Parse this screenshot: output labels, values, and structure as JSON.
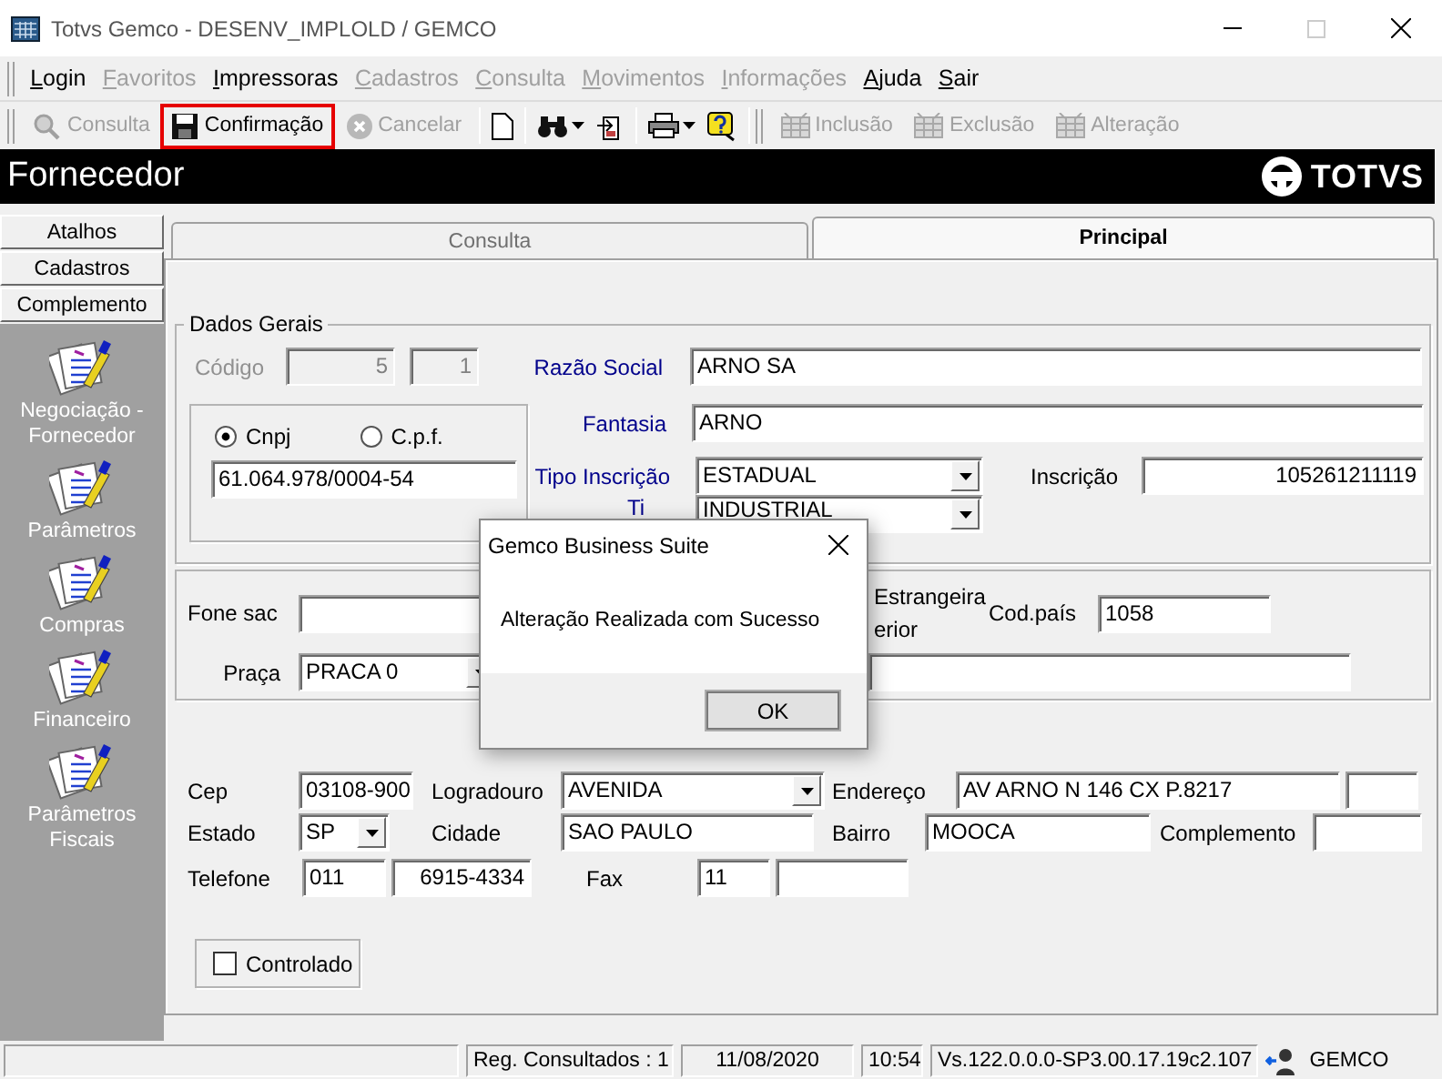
{
  "window": {
    "title": "Totvs Gemco - DESENV_IMPLOLD / GEMCO"
  },
  "menu": [
    {
      "label": "Login",
      "disabled": false
    },
    {
      "label": "Favoritos",
      "disabled": true
    },
    {
      "label": "Impressoras",
      "disabled": false
    },
    {
      "label": "Cadastros",
      "disabled": true
    },
    {
      "label": "Consulta",
      "disabled": true
    },
    {
      "label": "Movimentos",
      "disabled": true
    },
    {
      "label": "Informações",
      "disabled": true
    },
    {
      "label": "Ajuda",
      "disabled": false
    },
    {
      "label": "Sair",
      "disabled": false
    }
  ],
  "toolbar": [
    {
      "label": "Consulta",
      "disabled": true,
      "highlighted": false
    },
    {
      "label": "Confirmação",
      "disabled": false,
      "highlighted": true
    },
    {
      "label": "Cancelar",
      "disabled": true,
      "highlighted": false
    }
  ],
  "toolbar_2": [
    {
      "label": "Inclusão",
      "disabled": true
    },
    {
      "label": "Exclusão",
      "disabled": true
    },
    {
      "label": "Alteração",
      "disabled": true
    }
  ],
  "header": {
    "title": "Fornecedor",
    "logo": "TOTVS"
  },
  "sidebar": {
    "tabs": [
      {
        "label": "Atalhos"
      },
      {
        "label": "Cadastros"
      },
      {
        "label": "Complemento"
      }
    ],
    "items": [
      {
        "label": "Negociação -\nFornecedor"
      },
      {
        "label": "Parâmetros"
      },
      {
        "label": "Compras"
      },
      {
        "label": "Financeiro"
      },
      {
        "label": "Parâmetros\nFiscais"
      }
    ]
  },
  "tabs": [
    {
      "label": "Consulta",
      "selected": false
    },
    {
      "label": "Principal",
      "selected": true
    }
  ],
  "dados_gerais": {
    "title": "Dados Gerais",
    "codigo": {
      "label": "Código",
      "value": "5",
      "value_2": "1",
      "disabled": true
    },
    "razao_social": {
      "label": "Razão Social",
      "value": "ARNO SA",
      "required": true
    },
    "document_type": [
      {
        "label": "Cnpj",
        "selected": true
      },
      {
        "label": "C.p.f.",
        "selected": false
      }
    ],
    "document": "61.064.978/0004-54",
    "fantasia": {
      "label": "Fantasia",
      "value": "ARNO",
      "required": true
    },
    "tipo_inscricao": {
      "label": "Tipo Inscrição",
      "value": "ESTADUAL",
      "required": true
    },
    "inscricao": {
      "label": "Inscrição",
      "value": "105261211119",
      "required": false
    },
    "tipo": {
      "label": "Ti",
      "value": "INDUSTRIAL",
      "required": true
    }
  },
  "contato": {
    "fone_sac": {
      "label": "Fone sac"
    },
    "note_1": "Estrangeira",
    "note_2": "erior",
    "cod_pais": {
      "label": "Cod.país",
      "value": "1058"
    },
    "praca": {
      "label": "Praça",
      "value": "PRACA 0"
    }
  },
  "endereco": {
    "cep": {
      "label": "Cep",
      "value": "03108-900"
    },
    "logradouro": {
      "label": "Logradouro",
      "value": "AVENIDA"
    },
    "endereco": {
      "label": "Endereço",
      "value": "AV ARNO N 146 CX P.8217"
    },
    "estado": {
      "label": "Estado",
      "value": "SP"
    },
    "cidade": {
      "label": "Cidade",
      "value": "SAO PAULO"
    },
    "bairro": {
      "label": "Bairro",
      "value": "MOOCA"
    },
    "complemento": {
      "label": "Complemento"
    },
    "telefone": {
      "label": "Telefone",
      "ddd": "011",
      "value": "6915-4334"
    },
    "fax": {
      "label": "Fax",
      "ddd": "11"
    }
  },
  "controlado": {
    "label": "Controlado",
    "checked": false
  },
  "dialog": {
    "title": "Gemco Business Suite",
    "message": "Alteração Realizada com Sucesso",
    "button": "OK"
  },
  "status_bar": [
    "Reg. Consultados : 1",
    "11/08/2020",
    "10:54",
    "Vs.122.0.0.0-SP3.00.17.19c2.107",
    "GEMCO"
  ]
}
